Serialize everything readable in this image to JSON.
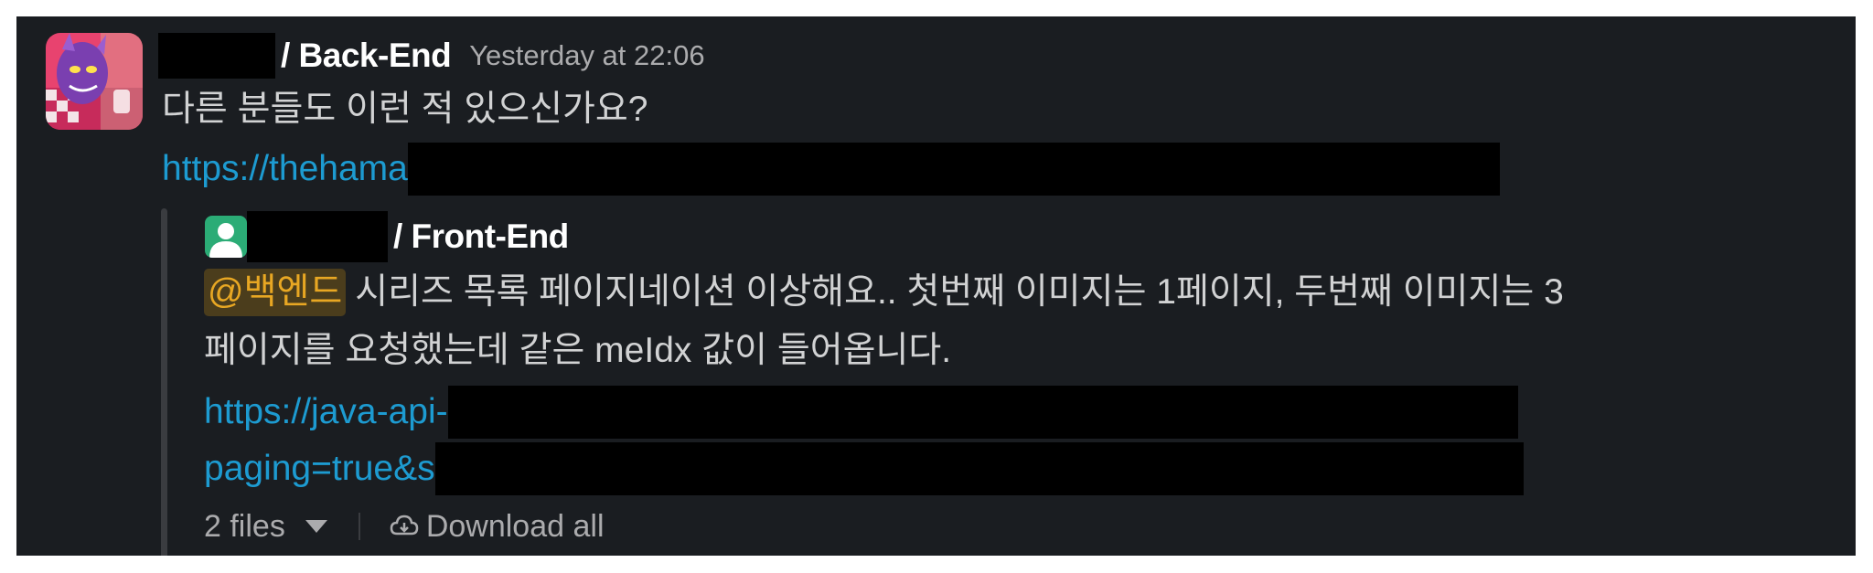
{
  "message": {
    "author_suffix": "/ Back-End",
    "timestamp": "Yesterday at 22:06",
    "text": "다른 분들도 이런 적 있으신가요?",
    "link_visible": "https://thehama"
  },
  "quoted": {
    "author_suffix": "/ Front-End",
    "mention": "@백엔드",
    "text_line1": "시리즈 목록 페이지네이션 이상해요.. 첫번째 이미지는 1페이지, 두번째 이미지는 3",
    "text_line2": "페이지를 요청했는데 같은 meIdx 값이 들어옵니다.",
    "link_line1": "https://java-api-",
    "link_line2": "paging=true&s"
  },
  "attachments": {
    "files_label": "2 files",
    "download_label": "Download all"
  }
}
